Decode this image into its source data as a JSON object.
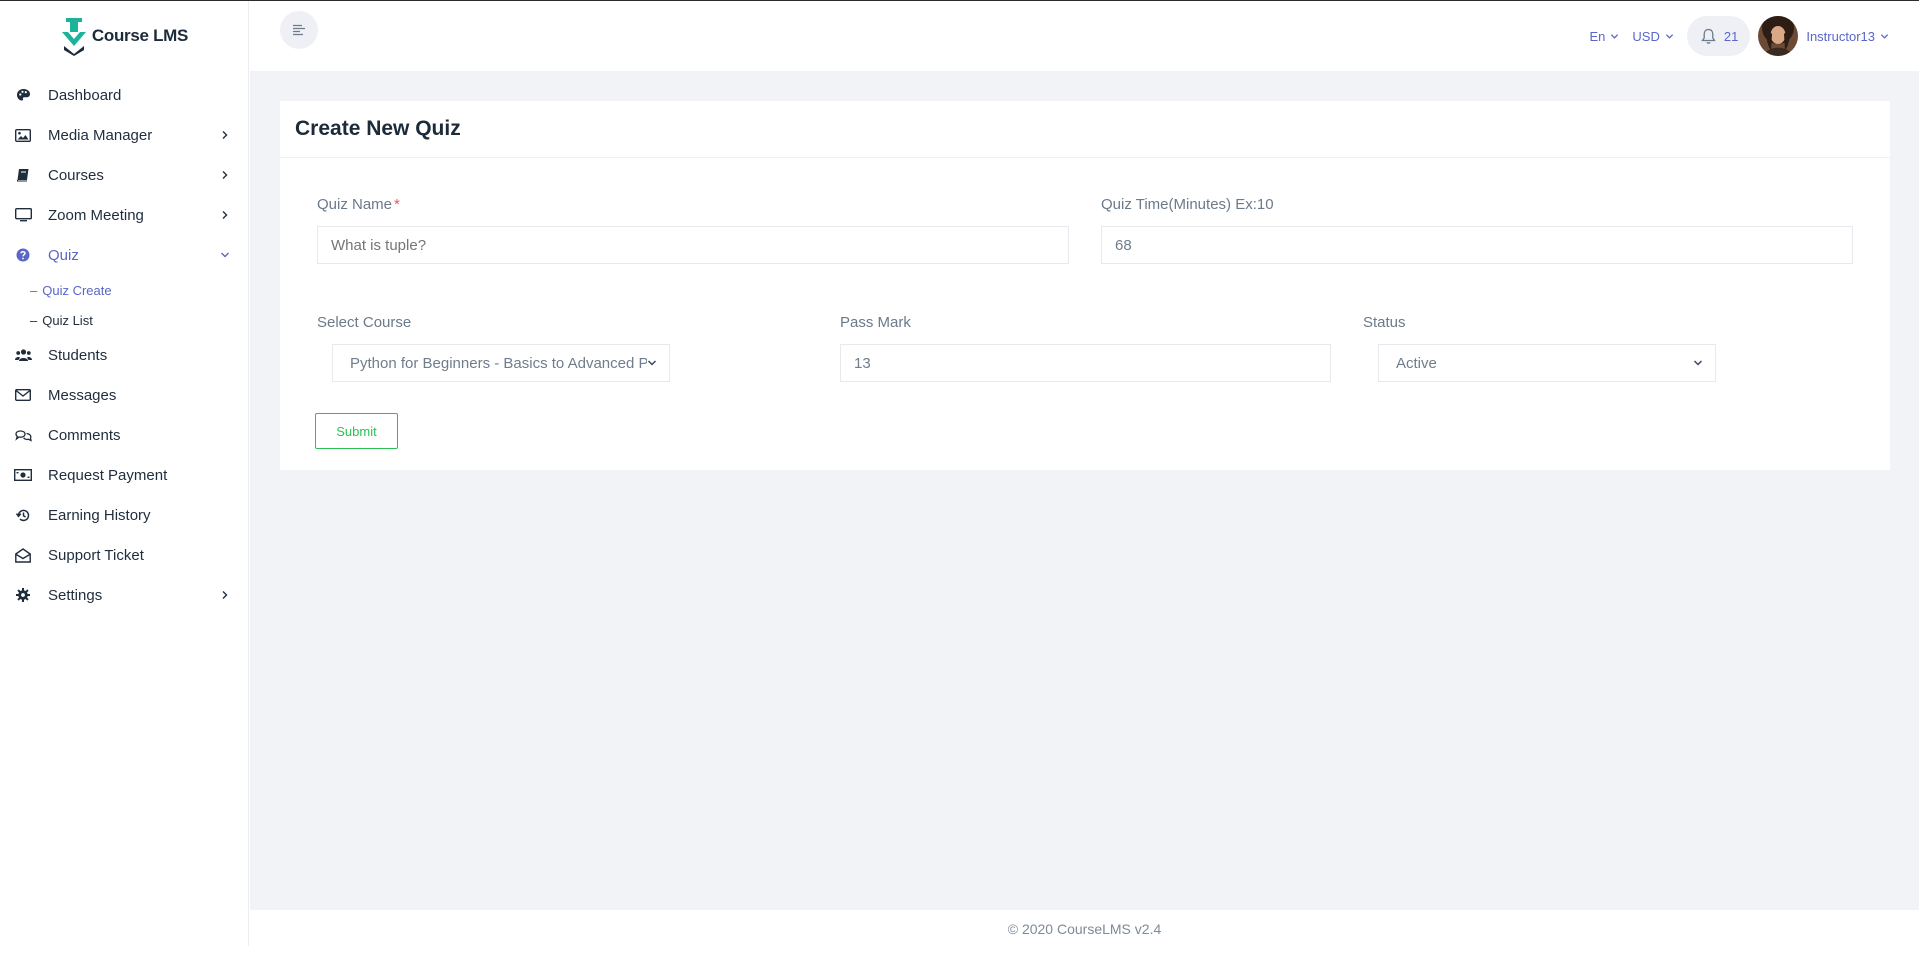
{
  "brand": {
    "name": "Course LMS"
  },
  "sidebar": {
    "items": [
      {
        "label": "Dashboard",
        "icon": "palette-icon"
      },
      {
        "label": "Media Manager",
        "icon": "image-icon"
      },
      {
        "label": "Courses",
        "icon": "book-icon"
      },
      {
        "label": "Zoom Meeting",
        "icon": "monitor-icon"
      },
      {
        "label": "Quiz",
        "icon": "question-circle-icon"
      },
      {
        "label": "Students",
        "icon": "users-icon"
      },
      {
        "label": "Messages",
        "icon": "envelope-icon"
      },
      {
        "label": "Comments",
        "icon": "comments-icon"
      },
      {
        "label": "Request Payment",
        "icon": "money-bill-icon"
      },
      {
        "label": "Earning History",
        "icon": "history-icon"
      },
      {
        "label": "Support Ticket",
        "icon": "envelope-open-icon"
      },
      {
        "label": "Settings",
        "icon": "gear-icon"
      }
    ],
    "quiz_submenu": [
      {
        "label": "Quiz Create"
      },
      {
        "label": "Quiz List"
      }
    ],
    "submenu_prefix": "–"
  },
  "topbar": {
    "language": "En",
    "currency": "USD",
    "notification_count": "21",
    "username": "Instructor13"
  },
  "page": {
    "title": "Create New Quiz"
  },
  "form": {
    "quiz_name_label": "Quiz Name",
    "required_mark": "*",
    "quiz_name_placeholder": "What is tuple?",
    "quiz_time_label": "Quiz Time(Minutes) Ex:10",
    "quiz_time_value": "68",
    "select_course_label": "Select Course",
    "select_course_value": "Python for Beginners - Basics to Advanced P",
    "pass_mark_label": "Pass Mark",
    "pass_mark_value": "13",
    "status_label": "Status",
    "status_value": "Active",
    "submit_label": "Submit"
  },
  "footer": {
    "text": "© 2020 CourseLMS v2.4"
  },
  "colors": {
    "accent": "#5a66c8",
    "submit_green": "#2bc155",
    "content_bg": "#f2f3f7"
  }
}
